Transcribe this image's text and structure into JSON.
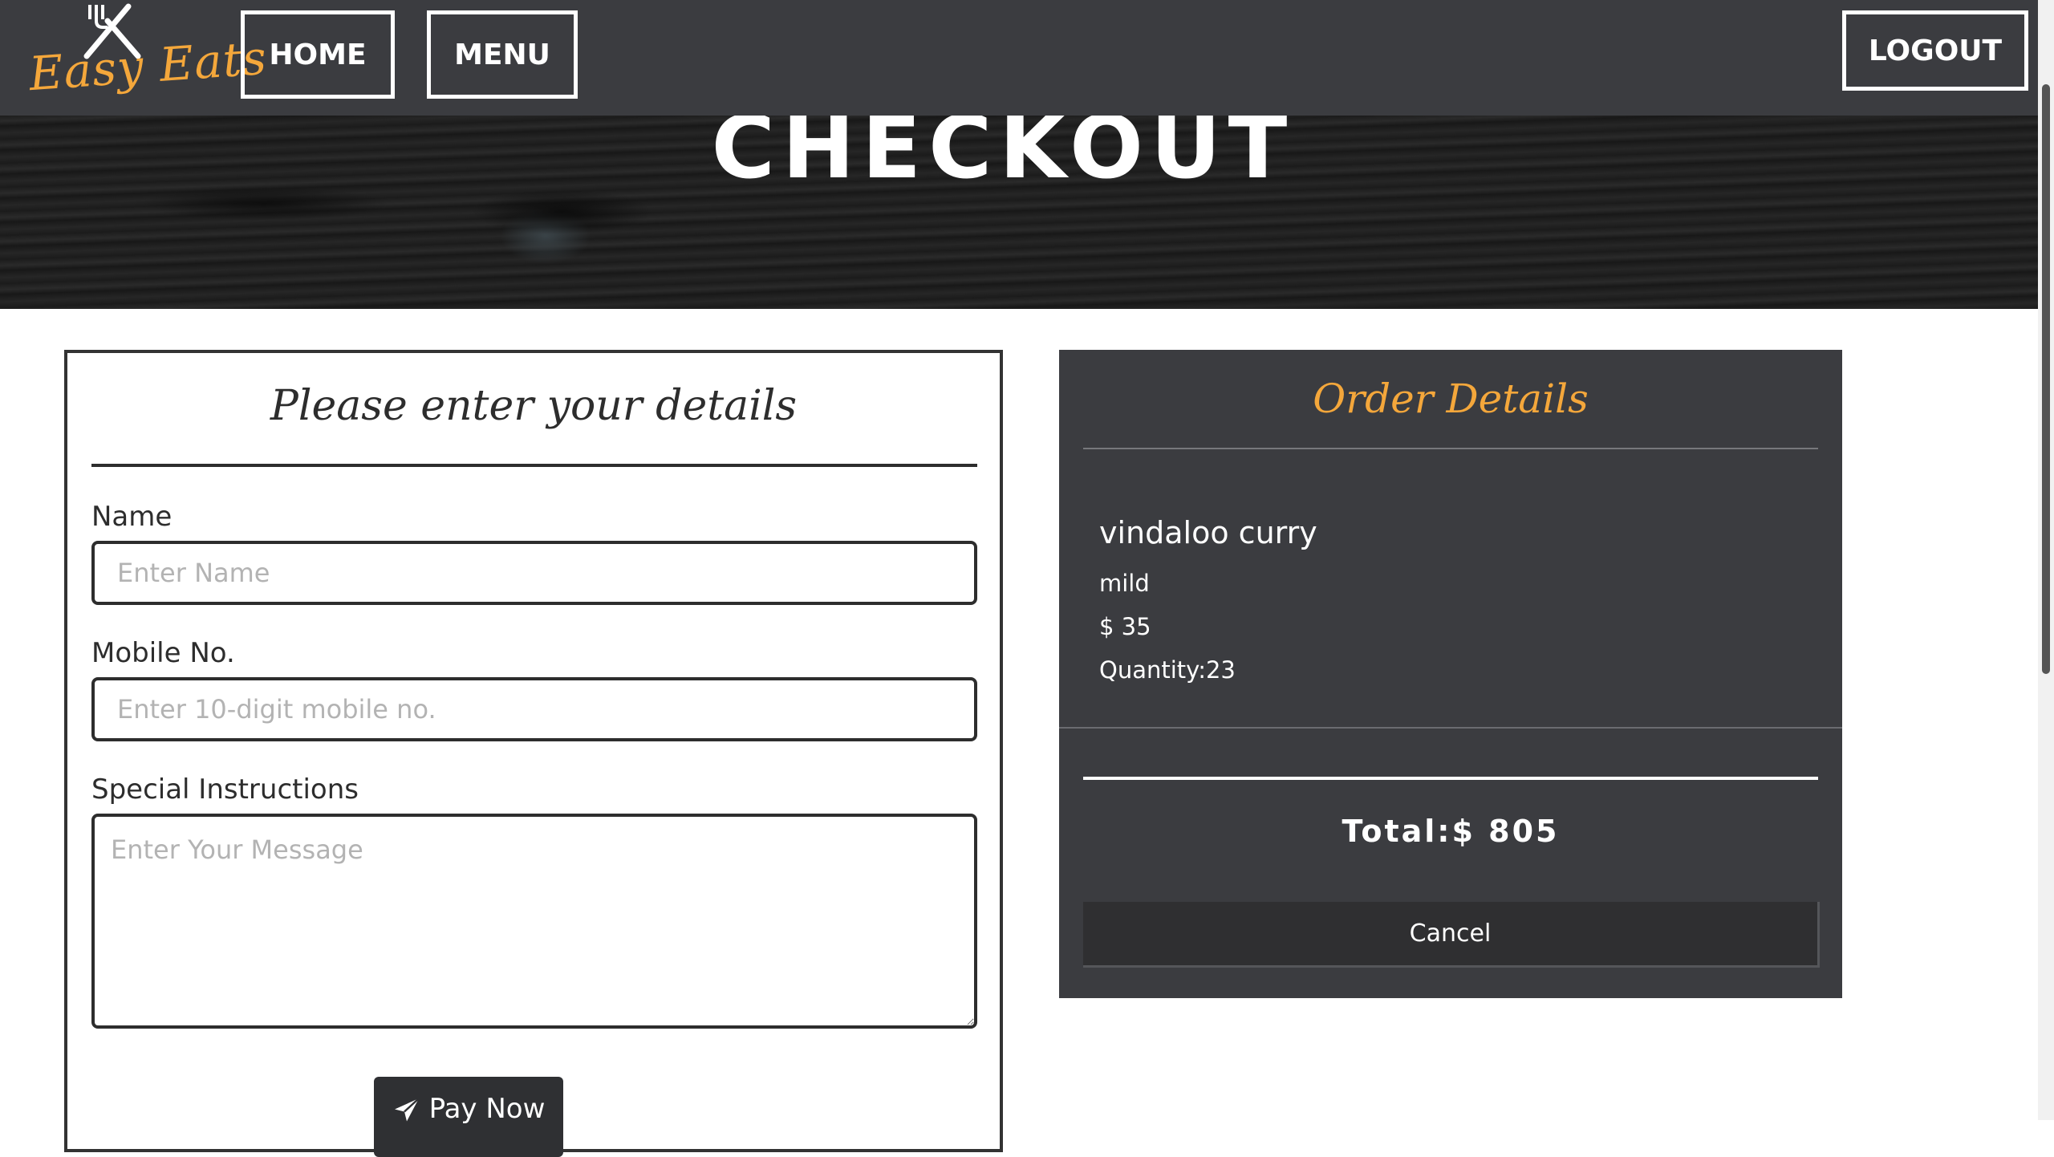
{
  "brand": {
    "logo_text": "Easy Eats",
    "accent_color": "#f4a73b"
  },
  "nav": {
    "home_label": "HOME",
    "menu_label": "MENU",
    "logout_label": "LOGOUT"
  },
  "hero": {
    "title": "CHECKOUT"
  },
  "details_form": {
    "title": "Please enter your details",
    "name_label": "Name",
    "name_placeholder": "Enter Name",
    "name_value": "",
    "mobile_label": "Mobile No.",
    "mobile_placeholder": "Enter 10-digit mobile no.",
    "mobile_value": "",
    "instructions_label": "Special Instructions",
    "instructions_placeholder": "Enter Your Message",
    "instructions_value": "",
    "pay_button_label": "Pay Now",
    "pay_icon": "paper-plane-icon"
  },
  "order_details": {
    "title": "Order Details",
    "items": [
      {
        "name": "vindaloo curry",
        "spice": "mild",
        "price": "$ 35",
        "quantity": "Quantity:23"
      }
    ],
    "total": "Total:$ 805",
    "cancel_label": "Cancel"
  }
}
